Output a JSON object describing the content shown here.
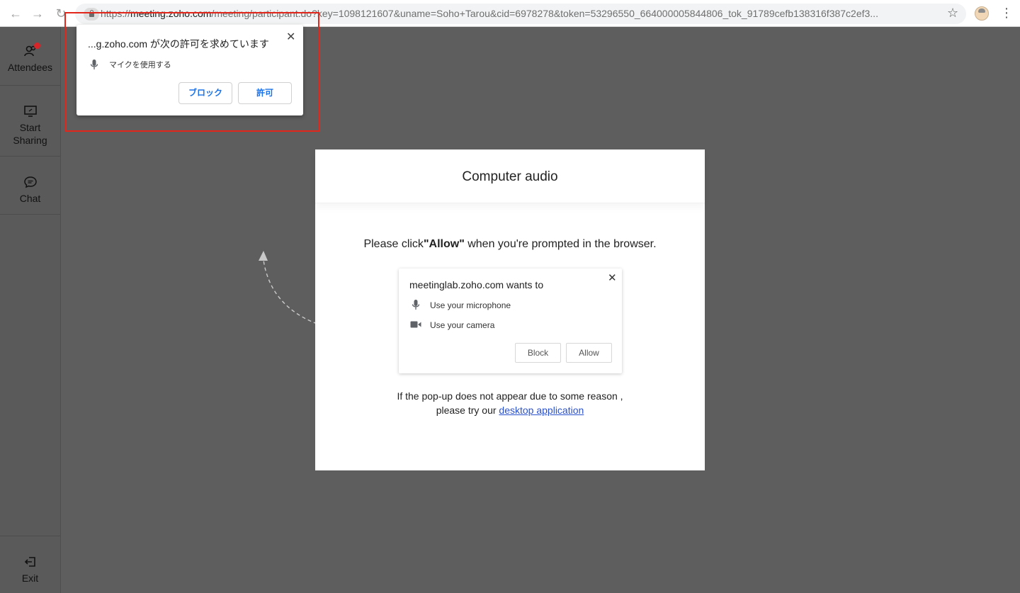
{
  "browser": {
    "back_icon": "arrow-left-icon",
    "forward_icon": "arrow-right-icon",
    "reload_icon": "reload-icon",
    "url_scheme": "https://",
    "url_host": "meeting.zoho.com",
    "url_rest": "/meeting/participant.do?key=1098121607&uname=Soho+Tarou&cid=6978278&token=53296550_664000005844806_tok_91789cefb138316f387c2ef3..."
  },
  "sidebar": {
    "attendees": "Attendees",
    "share_line1": "Start",
    "share_line2": "Sharing",
    "chat": "Chat",
    "exit": "Exit",
    "notification_color": "#d6262a"
  },
  "permission_popup": {
    "title": "...g.zoho.com が次の許可を求めています",
    "request": "マイクを使用する",
    "block_label": "ブロック",
    "allow_label": "許可",
    "highlight_color": "#e3261b"
  },
  "modal": {
    "title": "Computer audio",
    "instruction_pre": "Please click",
    "instruction_bold": "\"Allow\"",
    "instruction_post": " when you're prompted in the browser.",
    "illustration": {
      "title": "meetinglab.zoho.com wants to",
      "mic_line": "Use your microphone",
      "camera_line": "Use your camera",
      "block_label": "Block",
      "allow_label": "Allow"
    },
    "help_text": "If the pop-up does not appear due to some reason , please try our ",
    "help_link": "desktop application"
  }
}
